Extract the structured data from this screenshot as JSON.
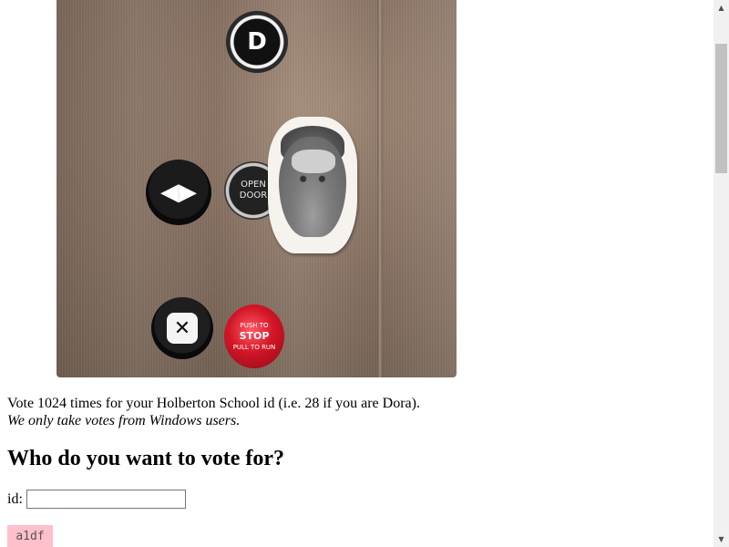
{
  "photo": {
    "buttons": {
      "floor_label": "D",
      "open_door_line1": "OPEN",
      "open_door_line2": "DOOR",
      "close_symbol": "✕",
      "open_symbol": "◀▶",
      "stop_top": "PUSH TO",
      "stop_main": "STOP",
      "stop_bottom": "PULL TO RUN"
    }
  },
  "intro": {
    "text": "Vote 1024 times for your Holberton School id (i.e. 28 if you are Dora).",
    "note": "We only take votes from Windows users."
  },
  "question": "Who do you want to vote for?",
  "form": {
    "id_label": "id:",
    "id_value": ""
  },
  "code_box": "a1df",
  "scrollbar": {
    "up_arrow": "▲",
    "down_arrow": "▼"
  }
}
